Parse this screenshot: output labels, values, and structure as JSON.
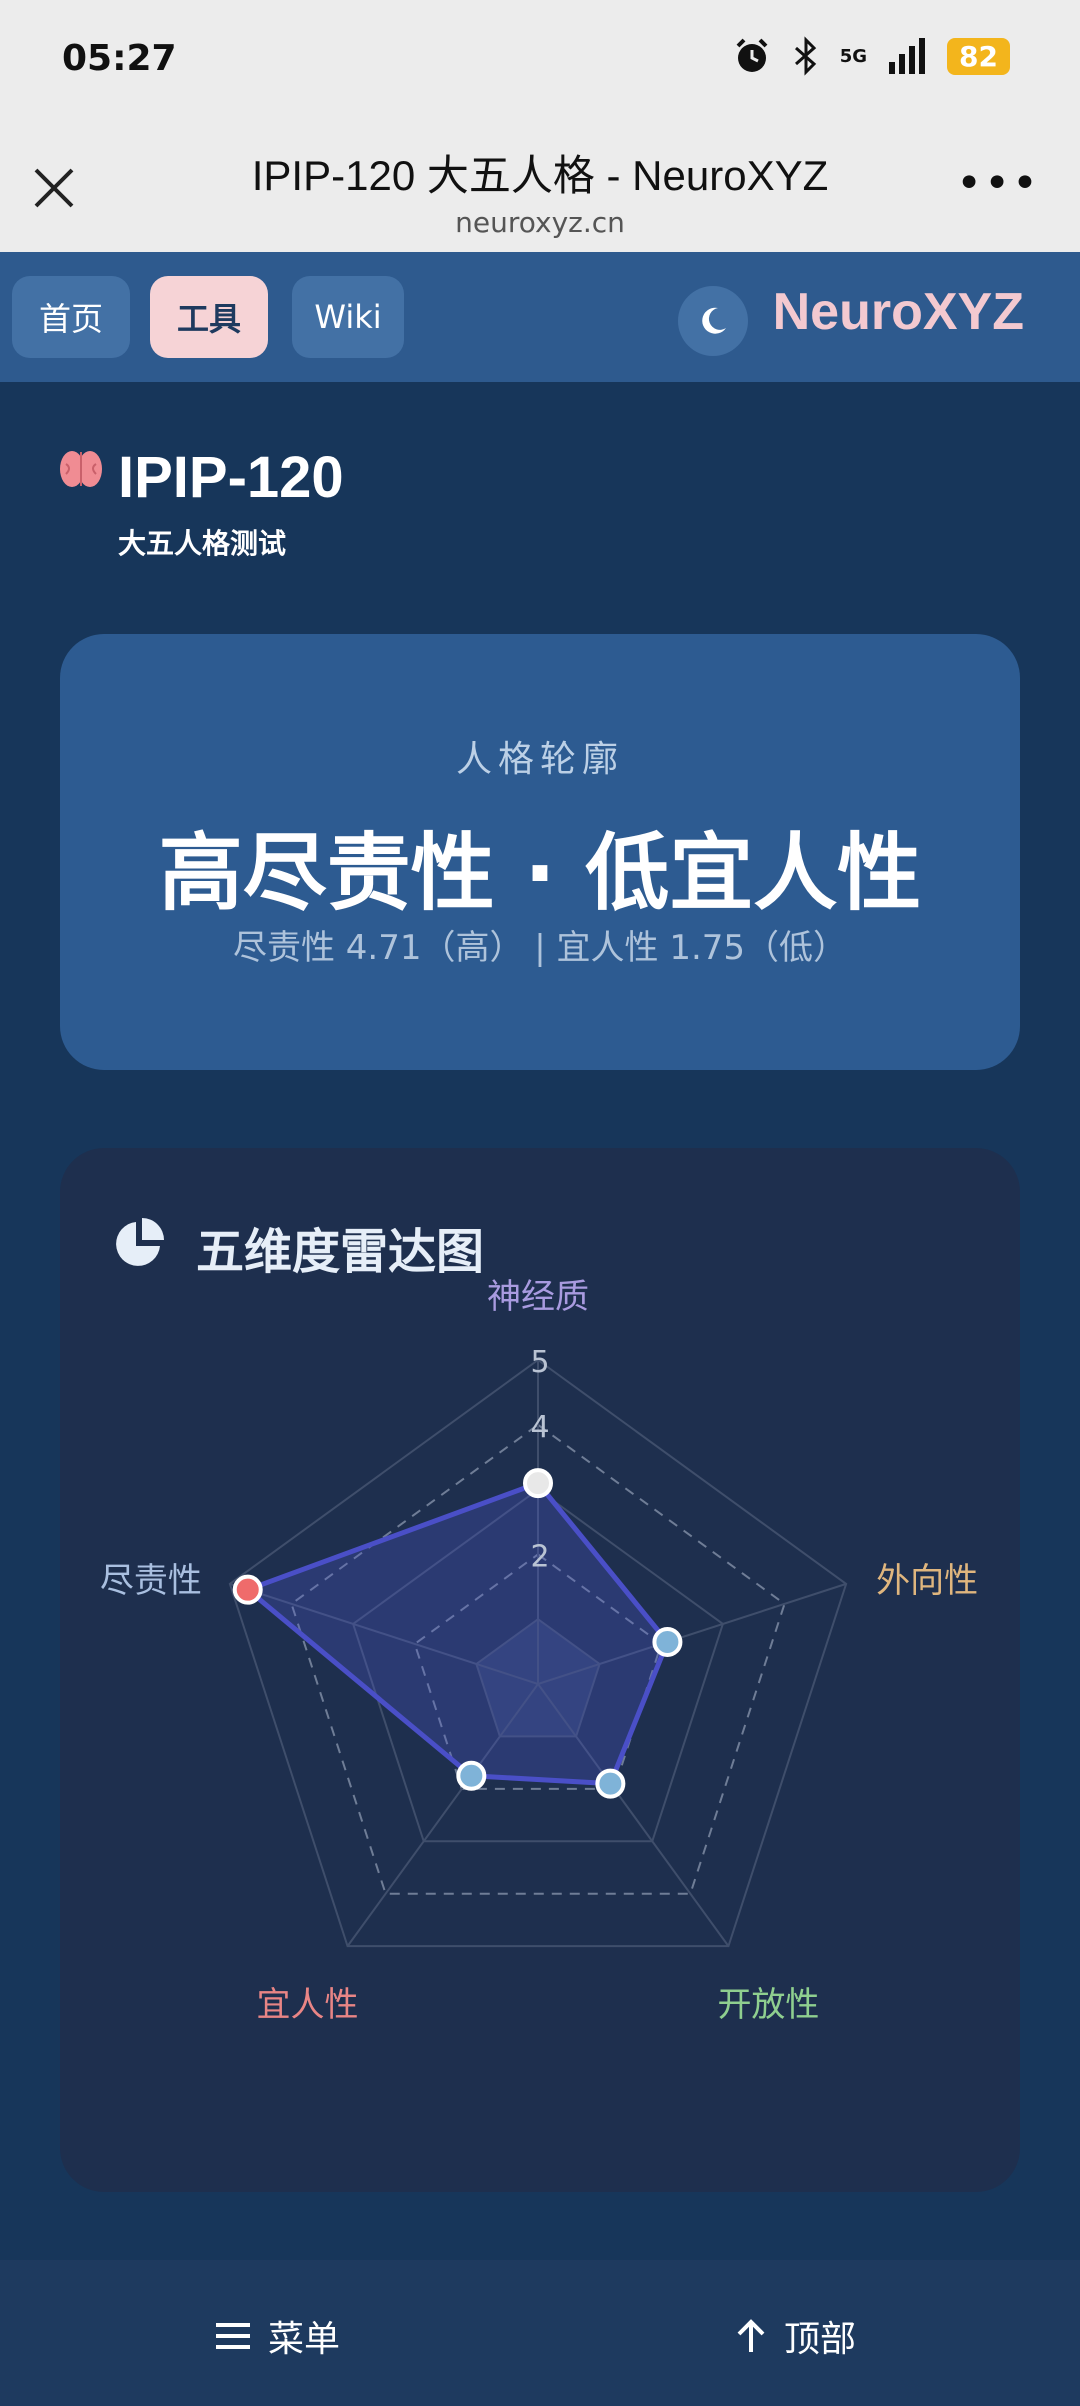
{
  "status": {
    "time": "05:27",
    "network": "5G",
    "battery": "82"
  },
  "browser": {
    "title": "IPIP-120 大五人格 - NeuroXYZ",
    "url": "neuroxyz.cn",
    "more": "•••"
  },
  "nav": {
    "home": "首页",
    "tools": "工具",
    "wiki": "Wiki",
    "brand": "NeuroXYZ"
  },
  "header": {
    "title": "IPIP-120",
    "subtitle": "大五人格测试"
  },
  "profile": {
    "label": "人格轮廓",
    "main": "高尽责性 · 低宜人性",
    "sub": "尽责性 4.71（高） | 宜人性 1.75（低）"
  },
  "radar_card": {
    "title": "五维度雷达图"
  },
  "chart_data": {
    "type": "radar",
    "axes": [
      "神经质",
      "外向性",
      "开放性",
      "宜人性",
      "尽责性"
    ],
    "axis_colors": [
      "#a99be0",
      "#e0b67e",
      "#8fcf8f",
      "#e98585",
      "#a9bfe0"
    ],
    "values": [
      3.1,
      2.1,
      1.9,
      1.75,
      4.71
    ],
    "point_colors": [
      "#e8e8e8",
      "#7fb3d8",
      "#7fb3d8",
      "#7fb3d8",
      "#ef6b6b"
    ],
    "rlim": [
      1,
      5
    ],
    "tick_labels": [
      "2",
      "4",
      "5"
    ],
    "line_color": "#4a4fc7"
  },
  "bottom": {
    "menu": "菜单",
    "top": "顶部"
  }
}
